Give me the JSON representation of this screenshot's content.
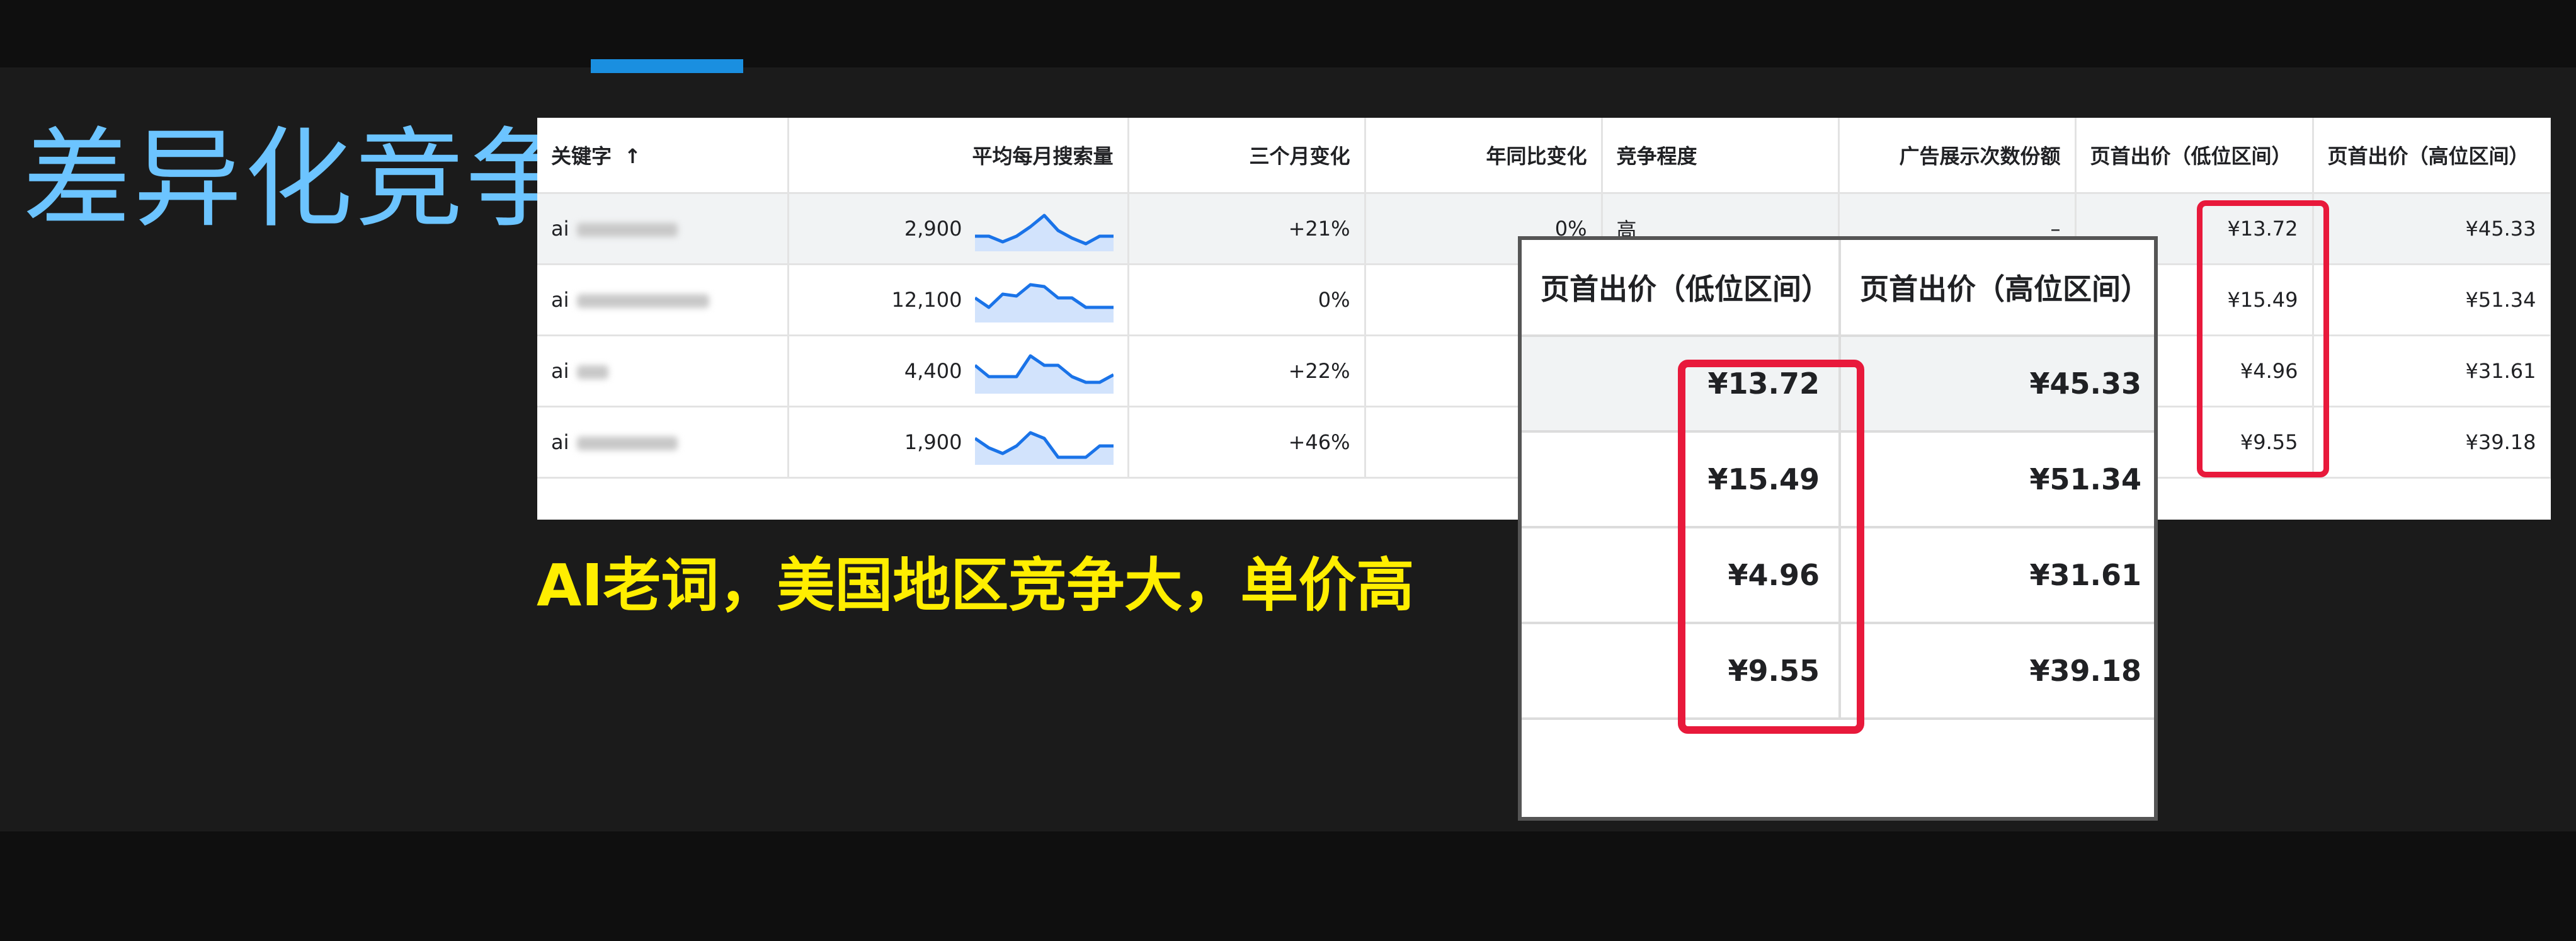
{
  "slide": {
    "title": "差异化竞争",
    "caption": "AI老词，美国地区竞争大，单价高"
  },
  "table": {
    "headers": {
      "keyword": "关键字",
      "avg_monthly_searches": "平均每月搜索量",
      "three_month_change": "三个月变化",
      "yoy_change": "年同比变化",
      "competition": "竞争程度",
      "ad_impression_share": "广告展示次数份额",
      "top_bid_low": "页首出价（低位区间）",
      "top_bid_high": "页首出价（高位区间）"
    },
    "rows": [
      {
        "keyword": "ai",
        "searches": "2,900",
        "trend": [
          0.3,
          0.3,
          0.15,
          0.3,
          0.55,
          0.85,
          0.45,
          0.25,
          0.1,
          0.3,
          0.3
        ],
        "three_month": "+21%",
        "yoy": "0%",
        "competition": "高",
        "impression_share": "–",
        "bid_low": "¥13.72",
        "bid_high": "¥45.33"
      },
      {
        "keyword": "ai",
        "searches": "12,100",
        "trend": [
          0.55,
          0.3,
          0.65,
          0.6,
          0.9,
          0.85,
          0.55,
          0.55,
          0.3,
          0.3,
          0.3
        ],
        "three_month": "0%",
        "yoy": "",
        "competition": "",
        "impression_share": "",
        "bid_low": "¥15.49",
        "bid_high": "¥51.34"
      },
      {
        "keyword": "ai",
        "searches": "4,400",
        "trend": [
          0.65,
          0.35,
          0.35,
          0.35,
          0.9,
          0.65,
          0.65,
          0.35,
          0.2,
          0.2,
          0.4
        ],
        "three_month": "+22%",
        "yoy": "",
        "competition": "",
        "impression_share": "",
        "bid_low": "¥4.96",
        "bid_high": "¥31.61"
      },
      {
        "keyword": "ai",
        "searches": "1,900",
        "trend": [
          0.6,
          0.35,
          0.2,
          0.4,
          0.75,
          0.6,
          0.1,
          0.1,
          0.1,
          0.4,
          0.4
        ],
        "three_month": "+46%",
        "yoy": "",
        "competition": "",
        "impression_share": "",
        "bid_low": "¥9.55",
        "bid_high": "¥39.18"
      }
    ]
  },
  "colors": {
    "title": "#6cc4ff",
    "caption": "#ffee00",
    "highlight_box": "#e8193b",
    "sparkline": "#1a73e8",
    "sparkline_fill": "#d2e3fc",
    "accent_bar": "#1a8fe0"
  }
}
